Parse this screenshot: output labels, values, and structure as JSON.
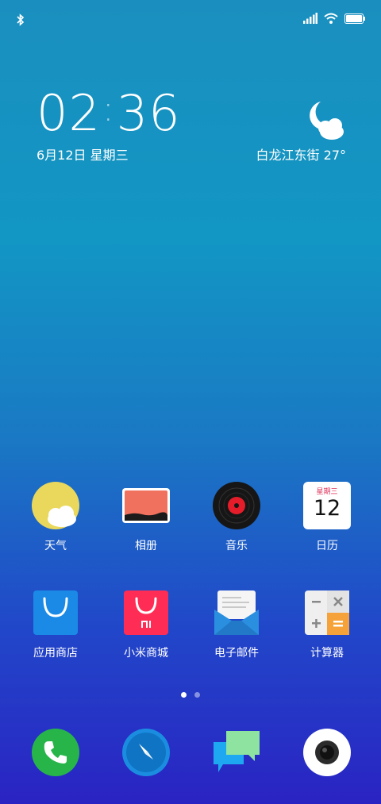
{
  "status_bar": {
    "icons": [
      "bluetooth-icon",
      "signal-icon",
      "wifi-icon",
      "battery-icon"
    ]
  },
  "clock": {
    "hours": "02",
    "minutes": "36",
    "date": "6月12日 星期三"
  },
  "weather": {
    "location_temp": "白龙江东街  27°",
    "icon": "moon-cloud-icon"
  },
  "apps_row1": [
    {
      "label": "天气",
      "icon": "weather-app-icon"
    },
    {
      "label": "相册",
      "icon": "gallery-app-icon"
    },
    {
      "label": "音乐",
      "icon": "music-app-icon"
    },
    {
      "label": "日历",
      "icon": "calendar-app-icon"
    }
  ],
  "calendar_icon": {
    "weekday": "星期三",
    "day": "12"
  },
  "apps_row2": [
    {
      "label": "应用商店",
      "icon": "app-store-icon"
    },
    {
      "label": "小米商城",
      "icon": "mi-store-icon"
    },
    {
      "label": "电子邮件",
      "icon": "email-app-icon"
    },
    {
      "label": "计算器",
      "icon": "calculator-app-icon"
    }
  ],
  "pager": {
    "pages": 2,
    "active": 0
  },
  "dock": [
    {
      "icon": "phone-app-icon"
    },
    {
      "icon": "browser-app-icon"
    },
    {
      "icon": "messages-app-icon"
    },
    {
      "icon": "camera-app-icon"
    }
  ],
  "colors": {
    "phone_green": "#27b54a",
    "browser_blue": "#1b8de0",
    "mi_red": "#ff2d55",
    "store_blue": "#1a8ae6",
    "calc_orange": "#f6a23a"
  }
}
